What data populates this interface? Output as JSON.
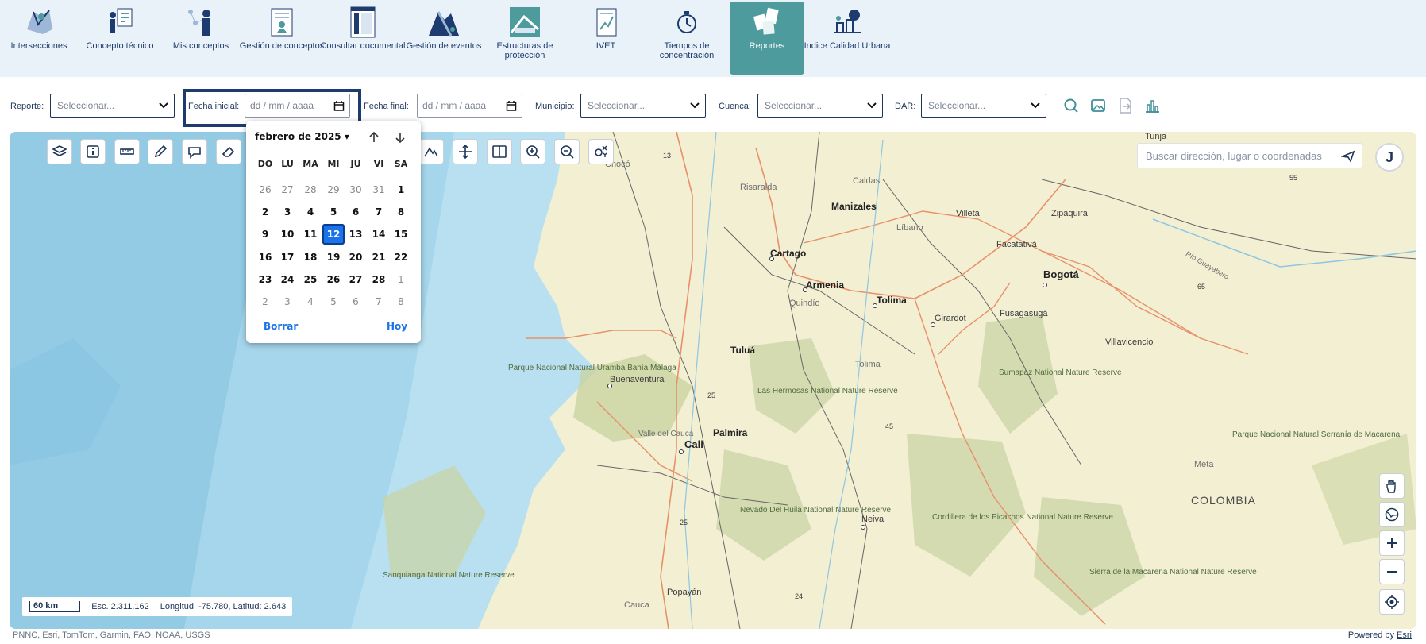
{
  "nav": {
    "modules": [
      {
        "label": "Intersecciones",
        "icon": "map-intersection-icon"
      },
      {
        "label": "Concepto técnico",
        "icon": "presenter-icon"
      },
      {
        "label": "Mis conceptos",
        "icon": "person-network-icon"
      },
      {
        "label": "Gestión de conceptos",
        "icon": "document-person-icon"
      },
      {
        "label": "Consultar documental",
        "icon": "folder-docs-icon"
      },
      {
        "label": "Gestión de eventos",
        "icon": "landslide-icon"
      },
      {
        "label": "Estructuras de protección",
        "icon": "structure-icon"
      },
      {
        "label": "IVET",
        "icon": "document-chart-icon"
      },
      {
        "label": "Tiempos de concentración",
        "icon": "stopwatch-icon"
      },
      {
        "label": "Reportes",
        "icon": "reports-icon",
        "active": true
      },
      {
        "label": "Indice Calidad Urbana",
        "icon": "urban-quality-icon"
      }
    ]
  },
  "filters": {
    "reporte_label": "Reporte:",
    "reporte_value": "Seleccionar...",
    "fecha_inicial_label": "Fecha inicial:",
    "fecha_inicial_value": "dd / mm / aaaa",
    "fecha_final_label": "Fecha final:",
    "fecha_final_value": "dd / mm / aaaa",
    "municipio_label": "Municipio:",
    "municipio_value": "Seleccionar...",
    "cuenca_label": "Cuenca:",
    "cuenca_value": "Seleccionar...",
    "dar_label": "DAR:",
    "dar_value": "Seleccionar..."
  },
  "datepicker": {
    "month_label": "febrero de 2025",
    "weekdays": [
      "DO",
      "LU",
      "MA",
      "MI",
      "JU",
      "VI",
      "SA"
    ],
    "weeks": [
      [
        "26",
        "27",
        "28",
        "29",
        "30",
        "31",
        "1"
      ],
      [
        "2",
        "3",
        "4",
        "5",
        "6",
        "7",
        "8"
      ],
      [
        "9",
        "10",
        "11",
        "12",
        "13",
        "14",
        "15"
      ],
      [
        "16",
        "17",
        "18",
        "19",
        "20",
        "21",
        "22"
      ],
      [
        "23",
        "24",
        "25",
        "26",
        "27",
        "28",
        "1"
      ],
      [
        "2",
        "3",
        "4",
        "5",
        "6",
        "7",
        "8"
      ]
    ],
    "selected_day": "12",
    "clear_label": "Borrar",
    "today_label": "Hoy"
  },
  "map": {
    "search_placeholder": "Buscar dirección, lugar o coordenadas",
    "user_initial": "J",
    "scale_label": "60 km",
    "scale_ratio": "Esc. 2.311.162",
    "coords": "Longitud: -75.780, Latitud: 2.643",
    "attribution": "PNNC, Esri, TomTom, Garmin, FAO, NOAA, USGS",
    "powered_by": "Powered by",
    "esri": "Esri",
    "places": {
      "tunja": "Tunja",
      "choco": "Chocó",
      "risaralda": "Risaralda",
      "caldas": "Caldas",
      "manizales": "Manizales",
      "libano": "Líbano",
      "villeta": "Villeta",
      "zipaquira": "Zipaquirá",
      "facatativa": "Facatativá",
      "bogota": "Bogotá",
      "cartago": "Cartago",
      "armenia": "Armenia",
      "quindio": "Quindío",
      "tolima_city": "Tolima",
      "girardot": "Girardot",
      "fusagasuga": "Fusagasugá",
      "villavicencio": "Villavicencio",
      "rio_guayabero": "Río Guayabero",
      "tulua": "Tuluá",
      "tolima_region": "Tolima",
      "uramba": "Parque Nacional Natural Uramba Bahía Málaga",
      "buenaventura": "Buenaventura",
      "hermosas": "Las Hermosas National Nature Reserve",
      "sumapaz": "Sumapaz National Nature Reserve",
      "valle": "Valle del Cauca",
      "palmira": "Palmira",
      "cali": "Cali",
      "macarena": "Parque Nacional Natural Serranía de Macarena",
      "meta": "Meta",
      "colombia": "COLOMBIA",
      "huila": "Nevado Del Huila National Nature Reserve",
      "neiva": "Neiva",
      "picachos": "Cordillera de los Picachos National Nature Reserve",
      "sanquianga": "Sanquianga National Nature Reserve",
      "popayan": "Popayán",
      "cauca": "Cauca",
      "sierra_macarena": "Sierra de la Macarena National Nature Reserve",
      "r13": "13",
      "r25a": "25",
      "r25b": "25",
      "r45": "45",
      "r55": "55",
      "r65": "65",
      "r24": "24"
    }
  },
  "colors": {
    "navy": "#1d3b6e",
    "active_tab": "#4e9b9e",
    "picker_selected": "#1a73e8",
    "ocean": "#bfe3f2",
    "land": "#f4f1d6"
  }
}
